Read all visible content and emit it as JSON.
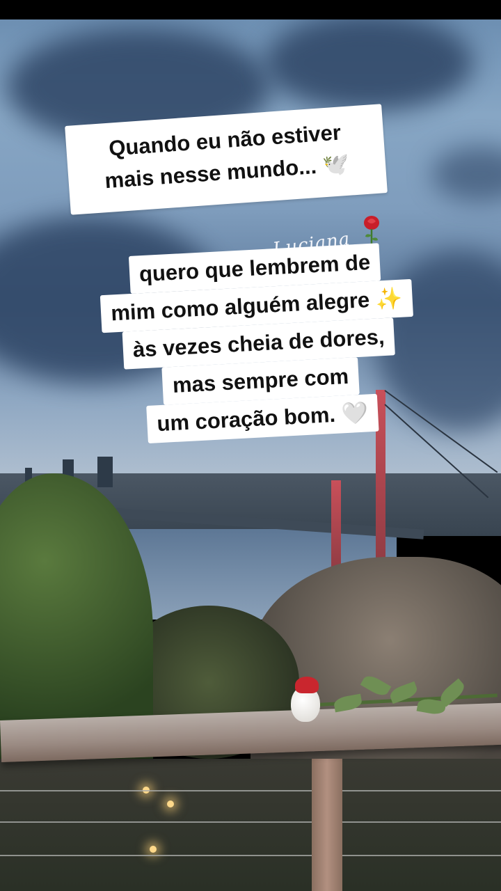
{
  "caption_top": {
    "line1": "Quando eu não estiver",
    "line2": "mais nesse mundo...",
    "emoji": "🕊️"
  },
  "signature": {
    "name": "Luciana",
    "emoji": "🌹"
  },
  "caption_bottom": {
    "lines": [
      "quero que lembrem de",
      "mim como alguém alegre",
      "às vezes cheia de dores,",
      "mas sempre com",
      "um coração bom."
    ],
    "emoji_line2": "✨",
    "emoji_line5": "🤍"
  },
  "colors": {
    "caption_bg": "#ffffff",
    "caption_text": "#111111",
    "signature": "#f3f5fa",
    "bridge_tower": "#c9505a"
  }
}
